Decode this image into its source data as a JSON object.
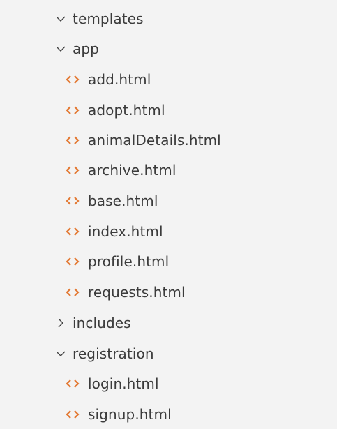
{
  "explorer": {
    "accent_file_icon_color": "#e37933",
    "chevron_color": "#424242",
    "items": [
      {
        "label": "templates",
        "kind": "folder",
        "expanded": true,
        "icon": "chevron-down-icon"
      },
      {
        "label": "app",
        "kind": "folder",
        "expanded": true,
        "icon": "chevron-down-icon"
      },
      {
        "label": "add.html",
        "kind": "file",
        "icon": "html-file-icon"
      },
      {
        "label": "adopt.html",
        "kind": "file",
        "icon": "html-file-icon"
      },
      {
        "label": "animalDetails.html",
        "kind": "file",
        "icon": "html-file-icon"
      },
      {
        "label": "archive.html",
        "kind": "file",
        "icon": "html-file-icon"
      },
      {
        "label": "base.html",
        "kind": "file",
        "icon": "html-file-icon"
      },
      {
        "label": "index.html",
        "kind": "file",
        "icon": "html-file-icon"
      },
      {
        "label": "profile.html",
        "kind": "file",
        "icon": "html-file-icon"
      },
      {
        "label": "requests.html",
        "kind": "file",
        "icon": "html-file-icon"
      },
      {
        "label": "includes",
        "kind": "folder",
        "expanded": false,
        "icon": "chevron-right-icon"
      },
      {
        "label": "registration",
        "kind": "folder",
        "expanded": true,
        "icon": "chevron-down-icon"
      },
      {
        "label": "login.html",
        "kind": "file",
        "icon": "html-file-icon"
      },
      {
        "label": "signup.html",
        "kind": "file",
        "icon": "html-file-icon"
      }
    ]
  }
}
